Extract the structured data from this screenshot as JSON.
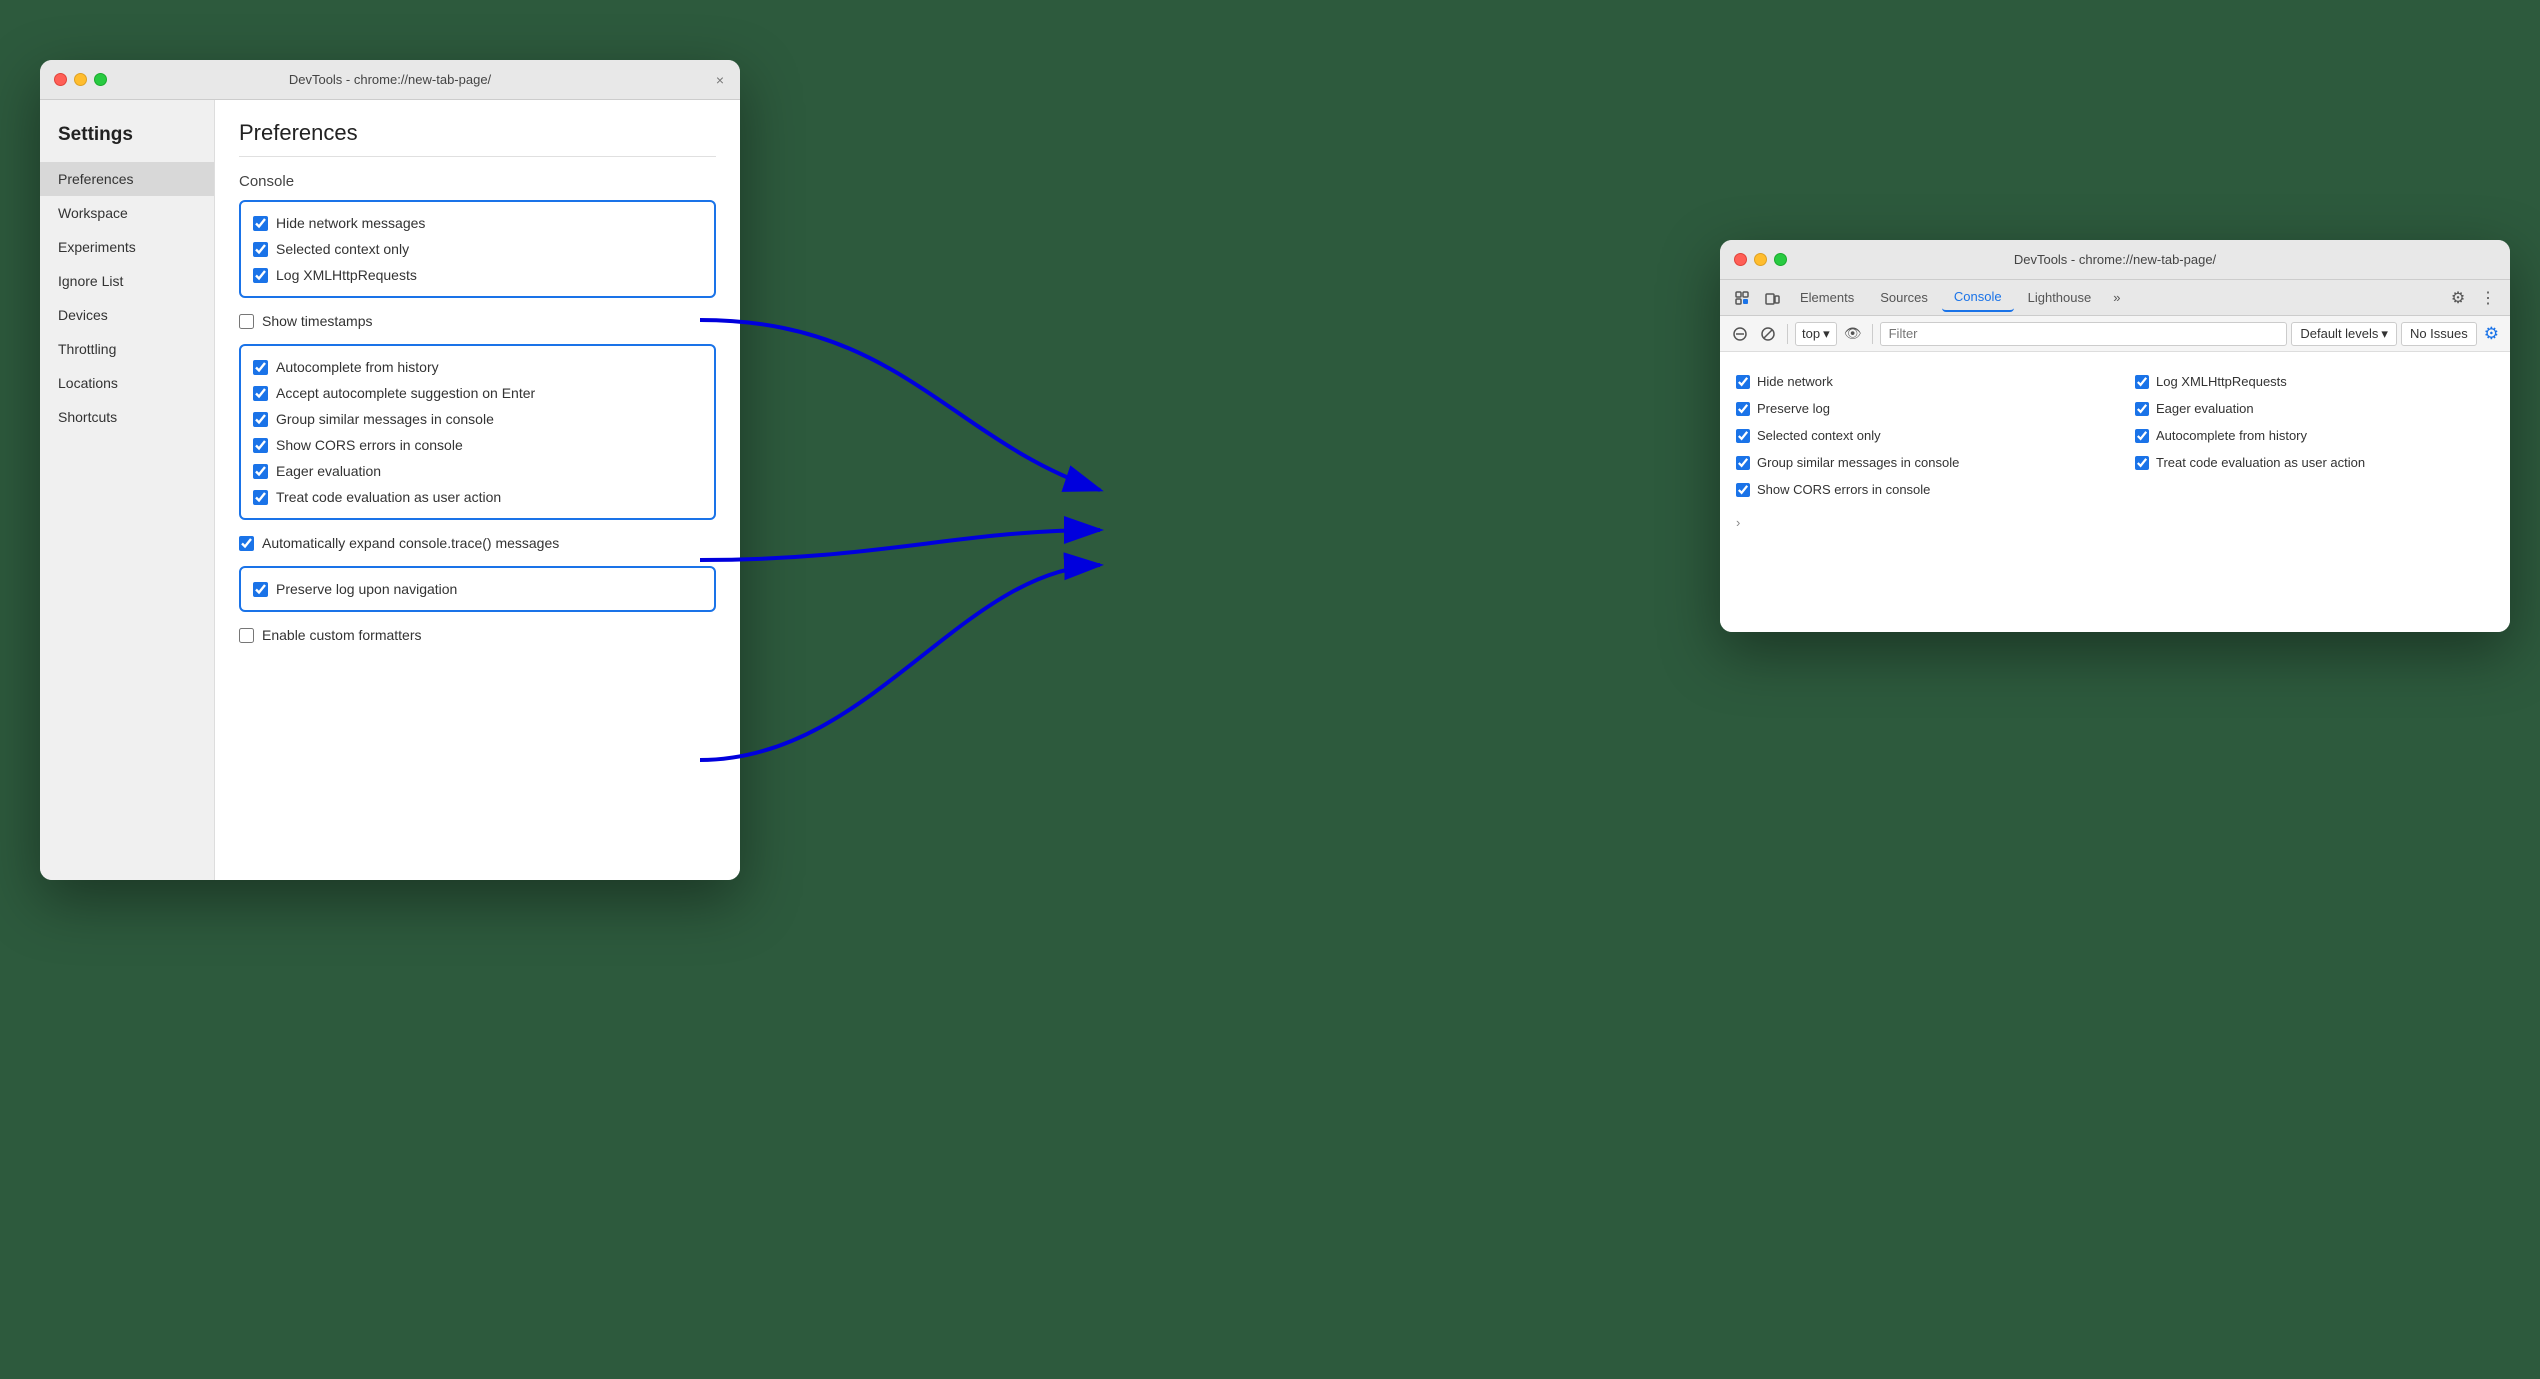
{
  "left_window": {
    "titlebar": {
      "title": "DevTools - chrome://new-tab-page/",
      "close_label": "×"
    },
    "sidebar": {
      "heading": "Settings",
      "items": [
        {
          "label": "Preferences",
          "active": true
        },
        {
          "label": "Workspace",
          "active": false
        },
        {
          "label": "Experiments",
          "active": false
        },
        {
          "label": "Ignore List",
          "active": false
        },
        {
          "label": "Devices",
          "active": false
        },
        {
          "label": "Throttling",
          "active": false
        },
        {
          "label": "Locations",
          "active": false
        },
        {
          "label": "Shortcuts",
          "active": false
        }
      ]
    },
    "main": {
      "page_title": "Preferences",
      "section_title": "Console",
      "group1": {
        "items": [
          {
            "label": "Hide network messages",
            "checked": true
          },
          {
            "label": "Selected context only",
            "checked": true
          },
          {
            "label": "Log XMLHttpRequests",
            "checked": true
          }
        ]
      },
      "item_show_timestamps": {
        "label": "Show timestamps",
        "checked": false
      },
      "group2": {
        "items": [
          {
            "label": "Autocomplete from history",
            "checked": true
          },
          {
            "label": "Accept autocomplete suggestion on Enter",
            "checked": true
          },
          {
            "label": "Group similar messages in console",
            "checked": true
          },
          {
            "label": "Show CORS errors in console",
            "checked": true
          },
          {
            "label": "Eager evaluation",
            "checked": true
          },
          {
            "label": "Treat code evaluation as user action",
            "checked": true
          }
        ]
      },
      "item_expand_trace": {
        "label": "Automatically expand console.trace() messages",
        "checked": true
      },
      "group3": {
        "items": [
          {
            "label": "Preserve log upon navigation",
            "checked": true
          }
        ]
      },
      "item_custom_formatters": {
        "label": "Enable custom formatters",
        "checked": false
      }
    }
  },
  "right_window": {
    "titlebar": {
      "title": "DevTools - chrome://new-tab-page/"
    },
    "tabs": [
      {
        "label": "Elements",
        "active": false
      },
      {
        "label": "Sources",
        "active": false
      },
      {
        "label": "Console",
        "active": true
      },
      {
        "label": "Lighthouse",
        "active": false
      },
      {
        "label": "»",
        "active": false
      }
    ],
    "toolbar": {
      "top_label": "top",
      "filter_placeholder": "Filter",
      "default_levels_label": "Default levels",
      "no_issues_label": "No Issues"
    },
    "console_items_left": [
      {
        "label": "Hide network",
        "checked": true
      },
      {
        "label": "Preserve log",
        "checked": true
      },
      {
        "label": "Selected context only",
        "checked": true
      },
      {
        "label": "Group similar messages in console",
        "checked": true
      },
      {
        "label": "Show CORS errors in console",
        "checked": true
      }
    ],
    "console_items_right": [
      {
        "label": "Log XMLHttpRequests",
        "checked": true
      },
      {
        "label": "Eager evaluation",
        "checked": true
      },
      {
        "label": "Autocomplete from history",
        "checked": true
      },
      {
        "label": "Treat code evaluation as user action",
        "checked": true
      }
    ]
  }
}
